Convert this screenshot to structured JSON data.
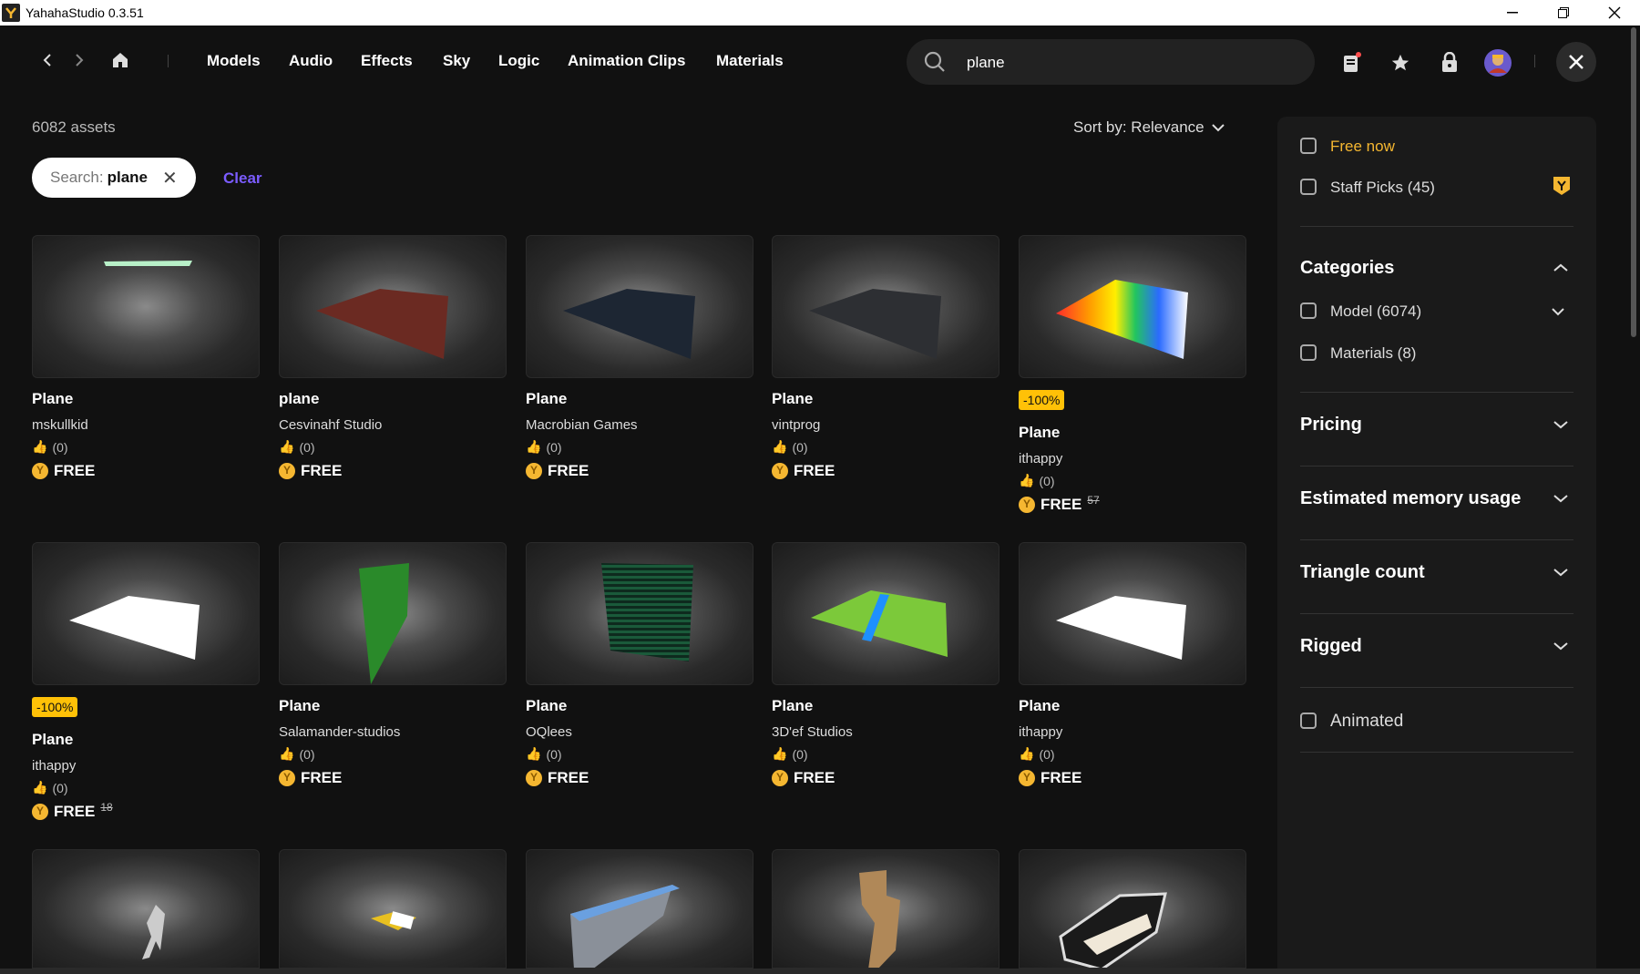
{
  "window": {
    "title": "YahahaStudio 0.3.51"
  },
  "nav": {
    "links": [
      "Models",
      "Audio",
      "Effects",
      "Sky",
      "Logic",
      "Animation Clips",
      "Materials"
    ]
  },
  "search": {
    "value": "plane"
  },
  "results": {
    "count": "6082 assets",
    "sort_label": "Sort by: Relevance"
  },
  "filter_chip": {
    "label": "Search:",
    "value": "plane",
    "clear": "Clear"
  },
  "cards": [
    {
      "name": "Plane",
      "author": "mskullkid",
      "rating": "(0)",
      "price": "FREE",
      "badge": "",
      "original": ""
    },
    {
      "name": "plane",
      "author": "Cesvinahf Studio",
      "rating": "(0)",
      "price": "FREE",
      "badge": "",
      "original": ""
    },
    {
      "name": "Plane",
      "author": "Macrobian Games",
      "rating": "(0)",
      "price": "FREE",
      "badge": "",
      "original": ""
    },
    {
      "name": "Plane",
      "author": "vintprog",
      "rating": "(0)",
      "price": "FREE",
      "badge": "",
      "original": ""
    },
    {
      "name": "Plane",
      "author": "ithappy",
      "rating": "(0)",
      "price": "FREE",
      "badge": "-100%",
      "original": "57"
    },
    {
      "name": "Plane",
      "author": "ithappy",
      "rating": "(0)",
      "price": "FREE",
      "badge": "-100%",
      "original": "18"
    },
    {
      "name": "Plane",
      "author": "Salamander-studios",
      "rating": "(0)",
      "price": "FREE",
      "badge": "",
      "original": ""
    },
    {
      "name": "Plane",
      "author": "OQlees",
      "rating": "(0)",
      "price": "FREE",
      "badge": "",
      "original": ""
    },
    {
      "name": "Plane",
      "author": "3D'ef Studios",
      "rating": "(0)",
      "price": "FREE",
      "badge": "",
      "original": ""
    },
    {
      "name": "Plane",
      "author": "ithappy",
      "rating": "(0)",
      "price": "FREE",
      "badge": "",
      "original": ""
    }
  ],
  "panel": {
    "free_now": "Free now",
    "staff_picks": "Staff Picks (45)",
    "categories": "Categories",
    "model": "Model (6074)",
    "materials": "Materials (8)",
    "pricing": "Pricing",
    "memory": "Estimated memory usage",
    "triangle": "Triangle count",
    "rigged": "Rigged",
    "animated": "Animated"
  },
  "colors": {
    "accent": "#7b5cff",
    "gold": "#ffc107",
    "free_now": "#f5b731"
  }
}
